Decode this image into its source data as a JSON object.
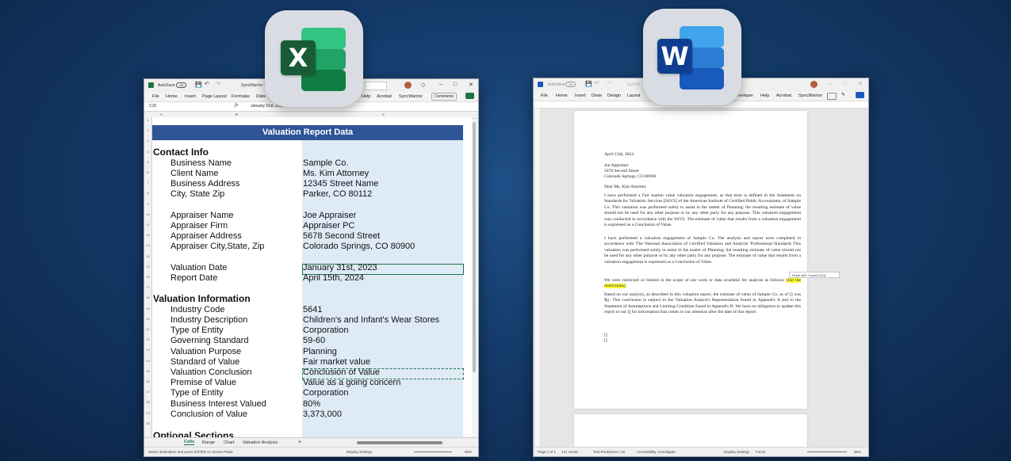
{
  "excel": {
    "app_letter": "X",
    "title": {
      "autosave": "AutoSave",
      "toggle": "Off",
      "file_name": "SyncWarrior 1"
    },
    "ribbon_tabs": [
      "File",
      "Home",
      "Insert",
      "Page Layout",
      "Formulas",
      "Data",
      "Help",
      "Acrobat",
      "SyncWarrior"
    ],
    "comments_label": "Comments",
    "name_box": "C15",
    "fx_label": "fx",
    "formula_value": "January 31st, 2023",
    "column_headers": [
      "A",
      "B",
      "C"
    ],
    "row_numbers": [
      "1",
      "2",
      "3",
      "4",
      "5",
      "6",
      "7",
      "8",
      "9",
      "10",
      "11",
      "12",
      "13",
      "14",
      "15",
      "16",
      "17",
      "18",
      "19",
      "20",
      "21",
      "22",
      "23",
      "24",
      "25",
      "26",
      "27",
      "28",
      "29",
      "30"
    ],
    "report_title": "Valuation Report Data",
    "sections": {
      "contact": "Contact Info",
      "valuation": "Valuation Information",
      "optional": "Optional Sections"
    },
    "contact_rows": [
      {
        "label": "Business Name",
        "value": "Sample Co."
      },
      {
        "label": "Client Name",
        "value": "Ms. Kim Attorney"
      },
      {
        "label": "Business Address",
        "value": "12345 Street Name"
      },
      {
        "label": "City, State Zip",
        "value": "Parker, CO 80112"
      }
    ],
    "appraiser_rows": [
      {
        "label": "Appraiser Name",
        "value": "Joe Appraiser"
      },
      {
        "label": "Appraiser Firm",
        "value": "Appraiser PC"
      },
      {
        "label": "Appraiser Address",
        "value": "5678 Second Street"
      },
      {
        "label": "Appraiser City,State, Zip",
        "value": "Colorado Springs, CO  80900"
      }
    ],
    "date_rows": [
      {
        "label": "Valuation Date",
        "value": "January 31st, 2023"
      },
      {
        "label": "Report Date",
        "value": "April 15th, 2024"
      }
    ],
    "valuation_rows": [
      {
        "label": "Industry Code",
        "value": "5641"
      },
      {
        "label": "Industry Description",
        "value": "Children's and Infant's Wear Stores"
      },
      {
        "label": "Type of Entity",
        "value": "Corporation"
      },
      {
        "label": "Governing Standard",
        "value": "59-60"
      },
      {
        "label": "Valuation Purpose",
        "value": "Planning"
      },
      {
        "label": "Standard of Value",
        "value": "Fair market value"
      },
      {
        "label": "Valuation Conclusion",
        "value": "Conclusion of Value"
      },
      {
        "label": "Premise of Value",
        "value": "Value as a going concern"
      },
      {
        "label": "Type of Entity",
        "value": "Corporation"
      },
      {
        "label": "Business Interest Valued",
        "value": "80%"
      },
      {
        "label": "Conclusion of Value",
        "value": "3,373,000"
      }
    ],
    "sheet_tabs": [
      "Cells",
      "Range",
      "Chart",
      "Valuation Analysis"
    ],
    "add_sheet": "+",
    "status_left": "Select destination and press ENTER or choose Paste",
    "status_right": "Display Settings",
    "zoom": "85%"
  },
  "word": {
    "app_letter": "W",
    "title": {
      "autosave": "AutoSave",
      "toggle": "Off",
      "file_name": "SyncW"
    },
    "ribbon_tabs": [
      "File",
      "Home",
      "Insert",
      "Draw",
      "Design",
      "Layout",
      "eveloper",
      "Help",
      "Acrobat",
      "SyncWarrior"
    ],
    "doc": {
      "date": "April 15th, 2024",
      "addr1": "Joe Appraiser",
      "addr2": "5678 Second Street",
      "addr3": "Colorado Springs, CO  80900",
      "salutation": "Dear Ms. Kim Attorney",
      "para1": "I have performed a Fair market value valuation engagement, as that term is defined in the Statement on Standards for Valuation Services [SSVS] of the American Institute of Certified Public Accountants, of Sample Co. This valuation was performed solely to assist in the matter of Planning; the resulting estimate of value should not be used for any other purpose or by any other party for any purpose. This valuation engagement was conducted in accordance with the SSVS. The estimate of value that results from a valuation engagement is expressed as a Conclusion of Value.",
      "para2": "I have performed a valuation engagement of Sample Co. The analysis and report were completed in accordance with 'The National Association of Certified Valuators and Analysts' Professional Standards This valuation was performed solely to assist in the matter of Planning; the resulting estimate of value should not be used for any other purpose or by any other party for any purpose. The estimate of value that results from a valuation engagement is expressed as a Conclusion of Value.",
      "para3_pre": "We were restricted or limited in the scope of our work or data available for analysis as follows: ",
      "para3_hl": "[list the restrictions]",
      "para4": "Based on our analysis, as described in this valuation report, the estimate of value of Sample Co. as of [] was $[]. This conclusion is subject to the Valuation Analyst's Representation found in Appendix A and to the Statement of Assumptions and Limiting Condition found in Appendix B. We have no obligation to update this report or our [] for information that comes to our attention after the date of this report.",
      "bracket1": "[]",
      "bracket2": "[]"
    },
    "paste_popup": "Paste with Copilot (Ctrl)",
    "status": {
      "page": "Page 1 of 1",
      "words": "131 words",
      "predictions": "Text Predictions: On",
      "accessibility": "Accessibility: Investigate",
      "display": "Display Settings",
      "focus": "Focus",
      "zoom": "86%"
    }
  },
  "colors": {
    "excel_green": "#1f7144",
    "word_blue": "#185abd",
    "banner": "#2f5597",
    "value_fill": "#deebf7",
    "highlight": "#ffff3a"
  }
}
